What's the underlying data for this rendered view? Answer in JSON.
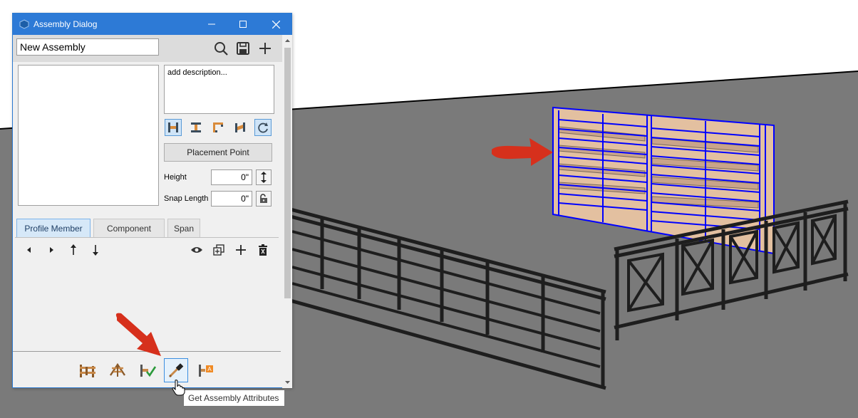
{
  "window": {
    "title": "Assembly Dialog",
    "assembly_name": "New Assembly",
    "description_placeholder": "add description...",
    "placement_point_label": "Placement Point",
    "height_label": "Height",
    "height_value": "0\"",
    "snap_length_label": "Snap Length",
    "snap_length_value": "0\"",
    "tabs": [
      {
        "label": "Profile Member",
        "active": true
      },
      {
        "label": "Component",
        "active": false
      },
      {
        "label": "Span",
        "active": false
      }
    ],
    "tooltip": "Get Assembly Attributes"
  },
  "icons": {
    "header": [
      "search-icon",
      "save-icon",
      "add-icon"
    ],
    "alignment": [
      "align-left-right-icon",
      "align-top-bottom-icon",
      "corner-align-icon",
      "skew-align-icon",
      "refresh-icon"
    ],
    "member": [
      "triangle-left-icon",
      "triangle-right-icon",
      "arrow-up-icon",
      "arrow-down-icon",
      "eye-icon",
      "duplicate-icon",
      "plus-icon",
      "delete-icon"
    ],
    "bottom": [
      "assembly-fence-icon",
      "assembly-fan-icon",
      "assembly-check-icon",
      "eyedropper-icon",
      "assembly-attribute-icon"
    ]
  },
  "colors": {
    "titlebar": "#2d7ad6",
    "selection": "#0000ff",
    "annotation_arrow": "#d6301c",
    "ground": "#7a7a7a",
    "railing": "#1e1e1e",
    "wood": "#e3c0a0"
  }
}
